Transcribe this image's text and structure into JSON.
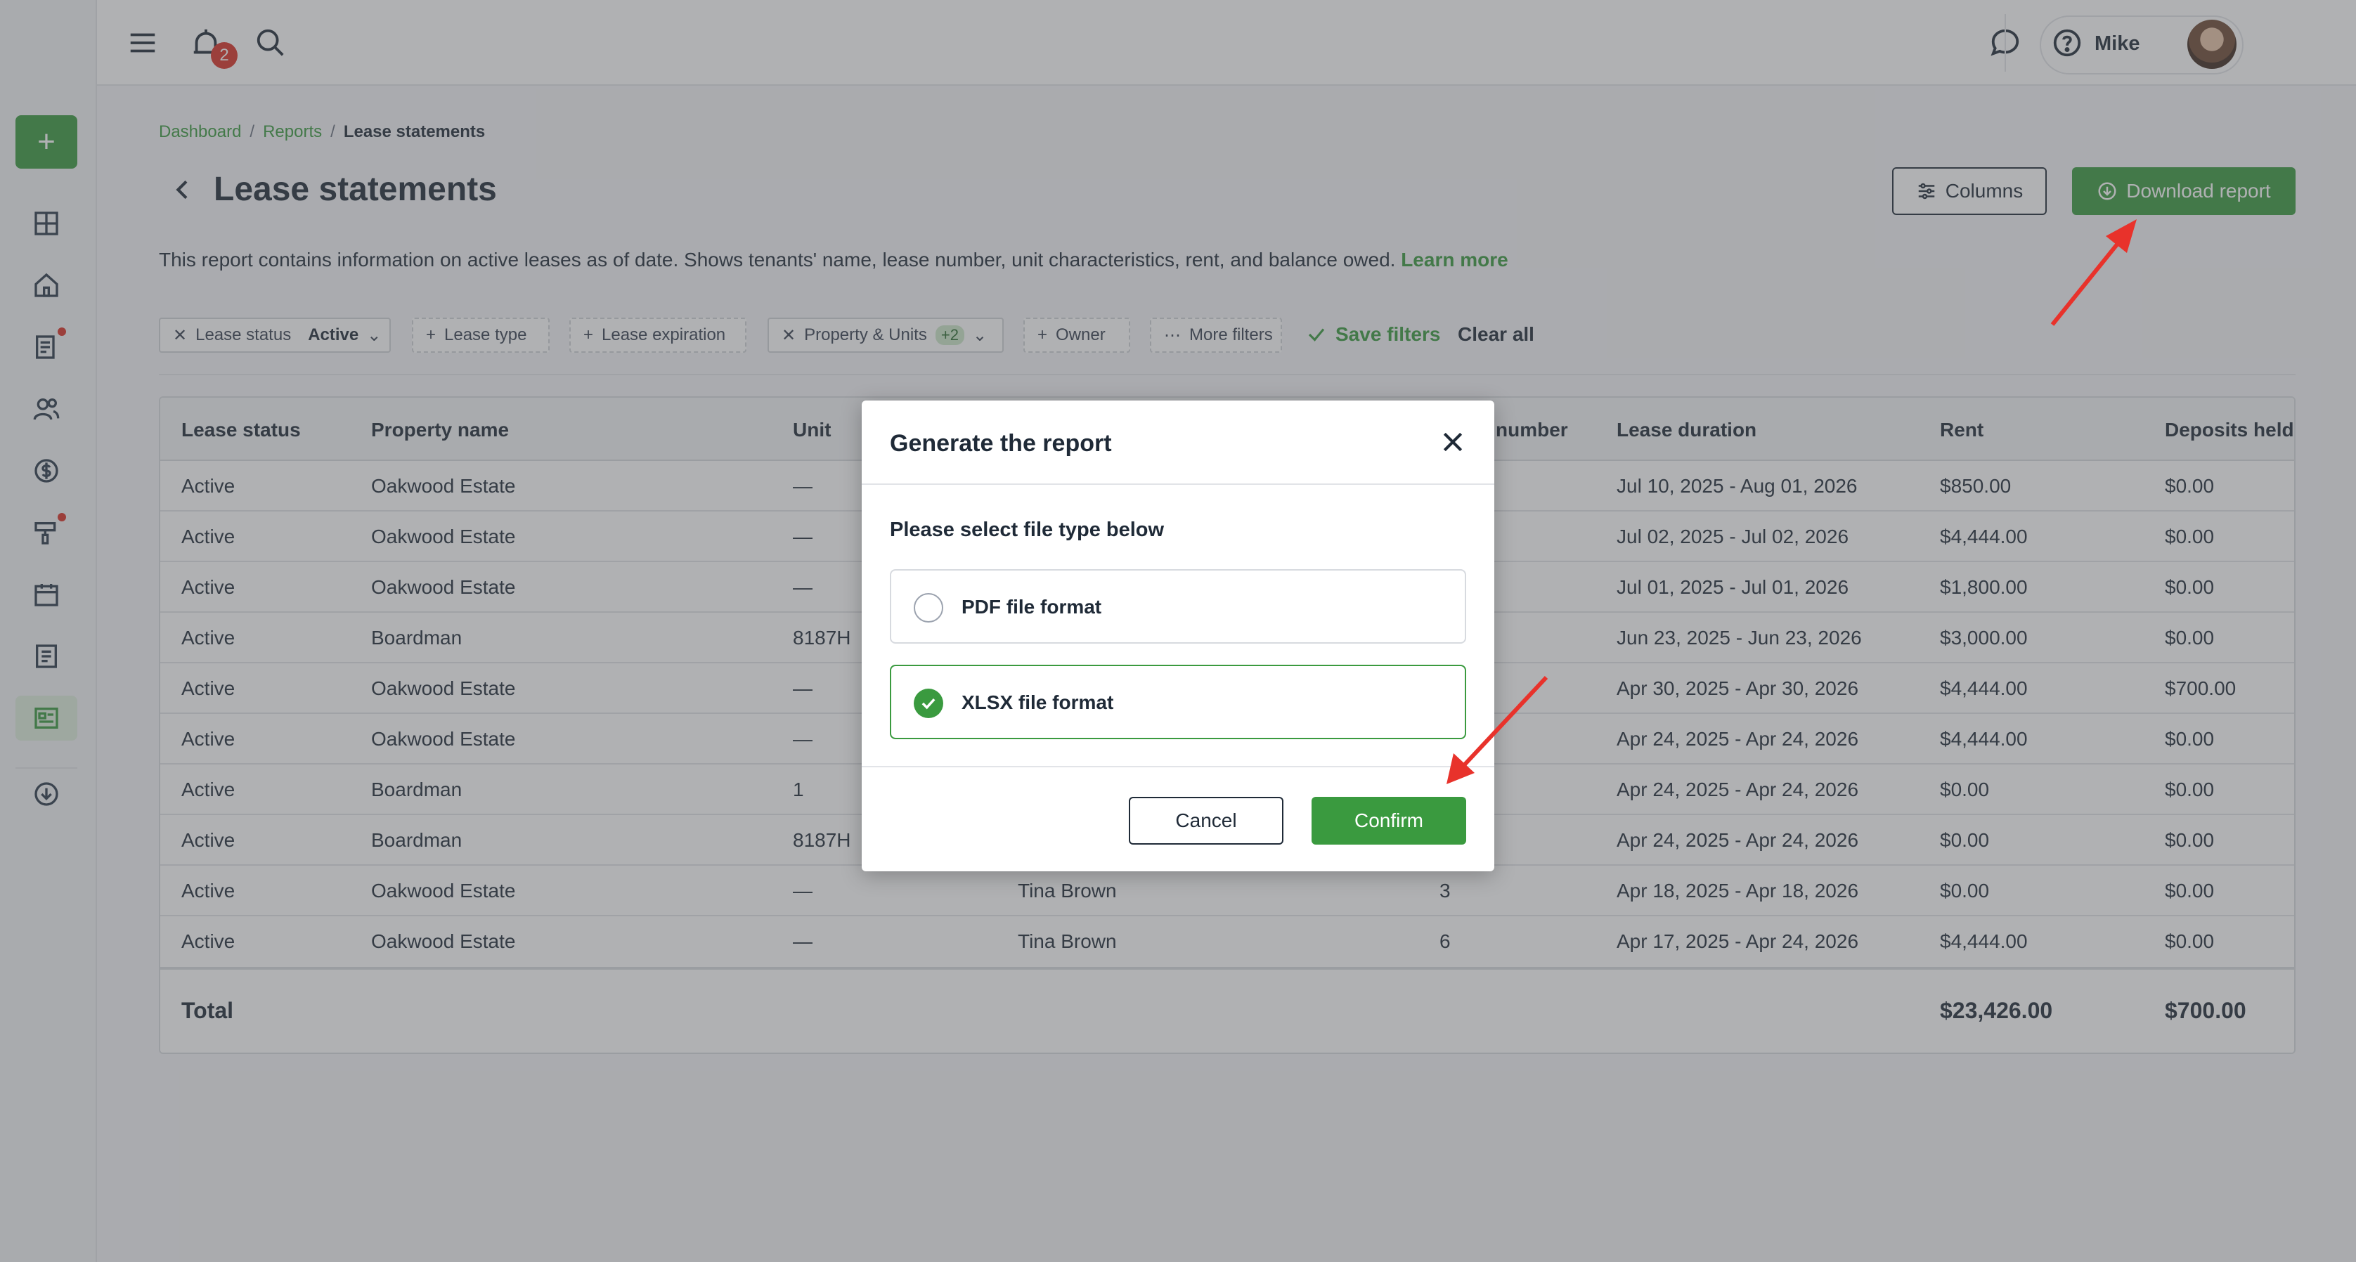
{
  "topbar": {
    "notifications_count": "2",
    "user_name": "Mike"
  },
  "breadcrumb": [
    "Dashboard",
    "Reports",
    "Lease statements"
  ],
  "page": {
    "title": "Lease statements",
    "description": "This report contains information on active leases as of date. Shows tenants' name, lease number, unit characteristics, rent, and balance owed.",
    "learn_more": "Learn more",
    "columns_button": "Columns",
    "download_button": "Download report"
  },
  "filters": {
    "lease_status_label": "Lease status",
    "lease_status_value": "Active",
    "lease_type": "Lease type",
    "lease_expiration": "Lease expiration",
    "property_units": "Property & Units",
    "property_units_count": "+2",
    "owner": "Owner",
    "more_filters": "More filters",
    "save_filters": "Save filters",
    "clear_all": "Clear all"
  },
  "table": {
    "headers": {
      "lease_status": "Lease status",
      "property_name": "Property name",
      "unit": "Unit",
      "lease_number_partial": "number",
      "lease_duration": "Lease duration",
      "rent": "Rent",
      "deposits_held": "Deposits held"
    },
    "rows": [
      {
        "status": "Active",
        "property": "Oakwood Estate",
        "unit": "—",
        "tenant": "",
        "number": "",
        "duration": "Jul 10, 2025 - Aug 01, 2026",
        "rent": "$850.00",
        "deposits": "$0.00"
      },
      {
        "status": "Active",
        "property": "Oakwood Estate",
        "unit": "—",
        "tenant": "",
        "number": "",
        "duration": "Jul 02, 2025 - Jul 02, 2026",
        "rent": "$4,444.00",
        "deposits": "$0.00"
      },
      {
        "status": "Active",
        "property": "Oakwood Estate",
        "unit": "—",
        "tenant": "",
        "number": "",
        "duration": "Jul 01, 2025 - Jul 01, 2026",
        "rent": "$1,800.00",
        "deposits": "$0.00"
      },
      {
        "status": "Active",
        "property": "Boardman",
        "unit": "8187H",
        "tenant": "",
        "number": "",
        "duration": "Jun 23, 2025 - Jun 23, 2026",
        "rent": "$3,000.00",
        "deposits": "$0.00"
      },
      {
        "status": "Active",
        "property": "Oakwood Estate",
        "unit": "—",
        "tenant": "",
        "number": "",
        "duration": "Apr 30, 2025 - Apr 30, 2026",
        "rent": "$4,444.00",
        "deposits": "$700.00"
      },
      {
        "status": "Active",
        "property": "Oakwood Estate",
        "unit": "—",
        "tenant": "",
        "number": "",
        "duration": "Apr 24, 2025 - Apr 24, 2026",
        "rent": "$4,444.00",
        "deposits": "$0.00"
      },
      {
        "status": "Active",
        "property": "Boardman",
        "unit": "1",
        "tenant": "",
        "number": "",
        "duration": "Apr 24, 2025 - Apr 24, 2026",
        "rent": "$0.00",
        "deposits": "$0.00"
      },
      {
        "status": "Active",
        "property": "Boardman",
        "unit": "8187H",
        "tenant": "",
        "number": "",
        "duration": "Apr 24, 2025 - Apr 24, 2026",
        "rent": "$0.00",
        "deposits": "$0.00"
      },
      {
        "status": "Active",
        "property": "Oakwood Estate",
        "unit": "—",
        "tenant": "Tina Brown",
        "number": "3",
        "duration": "Apr 18, 2025 - Apr 18, 2026",
        "rent": "$0.00",
        "deposits": "$0.00"
      },
      {
        "status": "Active",
        "property": "Oakwood Estate",
        "unit": "—",
        "tenant": "Tina Brown",
        "number": "6",
        "duration": "Apr 17, 2025 - Apr 24, 2026",
        "rent": "$4,444.00",
        "deposits": "$0.00"
      }
    ],
    "total_label": "Total",
    "total_rent": "$23,426.00",
    "total_deposits": "$700.00"
  },
  "modal": {
    "title": "Generate the report",
    "subtitle": "Please select file type below",
    "options": [
      {
        "label": "PDF file format",
        "selected": false
      },
      {
        "label": "XLSX file format",
        "selected": true
      }
    ],
    "cancel": "Cancel",
    "confirm": "Confirm"
  },
  "colors": {
    "brand_green": "#3a9a3f",
    "annotation_red": "#e8322b"
  }
}
